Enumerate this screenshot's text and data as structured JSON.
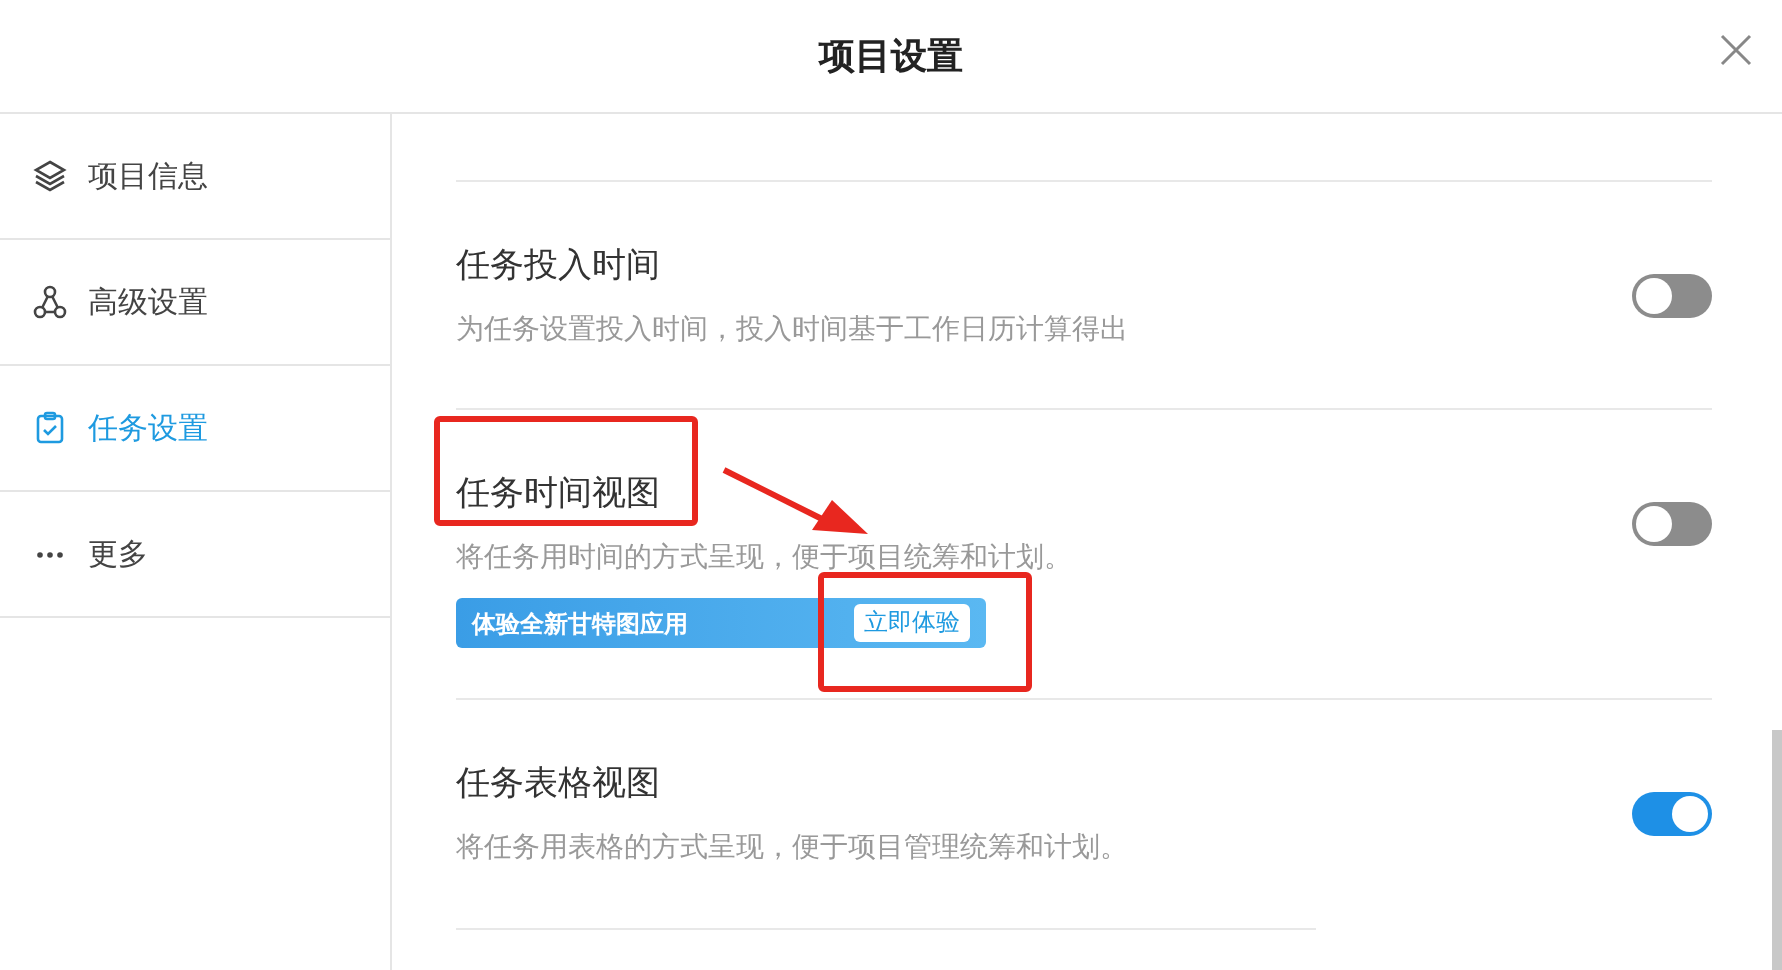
{
  "dialog": {
    "title": "项目设置"
  },
  "sidebar": {
    "items": [
      {
        "label": "项目信息",
        "selected": false
      },
      {
        "label": "高级设置",
        "selected": false
      },
      {
        "label": "任务设置",
        "selected": true
      },
      {
        "label": "更多",
        "selected": false
      }
    ]
  },
  "settings": [
    {
      "title": "任务投入时间",
      "description": "为任务设置投入时间，投入时间基于工作日历计算得出",
      "on": false
    },
    {
      "title": "任务时间视图",
      "description": "将任务用时间的方式呈现，便于项目统筹和计划。",
      "on": false,
      "banner": {
        "text": "体验全新甘特图应用",
        "button": "立即体验"
      }
    },
    {
      "title": "任务表格视图",
      "description": "将任务用表格的方式呈现，便于项目管理统筹和计划。",
      "on": true
    }
  ]
}
